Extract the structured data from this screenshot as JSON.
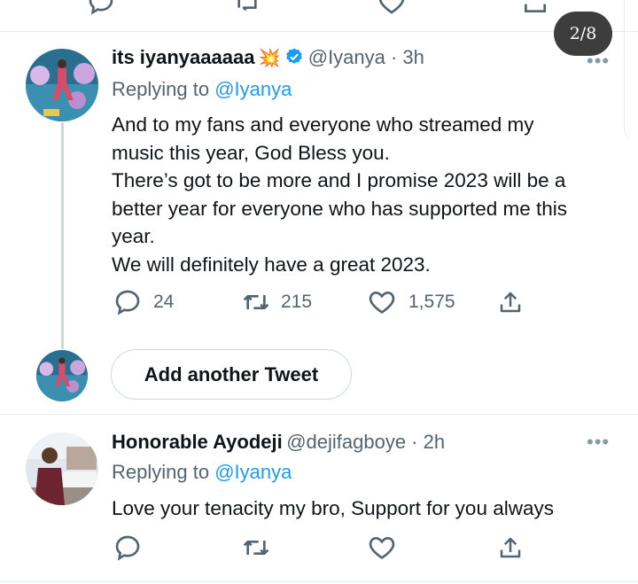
{
  "header": {
    "page_indicator": "2/8"
  },
  "tweets": [
    {
      "display_name": "its iyanyaaaaaa",
      "name_emoji": "💥",
      "verified": true,
      "handle_time": "@Iyanya · 3h",
      "replying_prefix": "Replying to ",
      "replying_to": "@Iyanya",
      "text_lines": [
        "And to my fans and everyone who streamed my",
        "music this year, God Bless you.",
        "There’s got to be more and I promise 2023 will be a",
        "better year for everyone who has supported me this",
        "year.",
        "We will definitely have a great 2023."
      ],
      "replies": "24",
      "retweets": "215",
      "likes": "1,575",
      "more": "•••"
    },
    {
      "display_name": "Honorable Ayodeji",
      "handle_time": "@dejifagboye · 2h",
      "replying_prefix": "Replying to ",
      "replying_to": "@Iyanya",
      "text_lines": [
        "Love your tenacity my bro, Support for you always"
      ],
      "more": "•••"
    }
  ],
  "composer": {
    "add_button_label": "Add another Tweet"
  },
  "icons": {
    "reply": "reply-icon",
    "retweet": "retweet-icon",
    "like": "like-icon",
    "share": "share-icon",
    "verified": "verified-badge-icon",
    "more": "more-options-icon"
  },
  "colors": {
    "link": "#1d9bf0",
    "secondary_text": "#536471",
    "verified": "#1d9bf0",
    "badge_bg": "#3d3d3d"
  }
}
